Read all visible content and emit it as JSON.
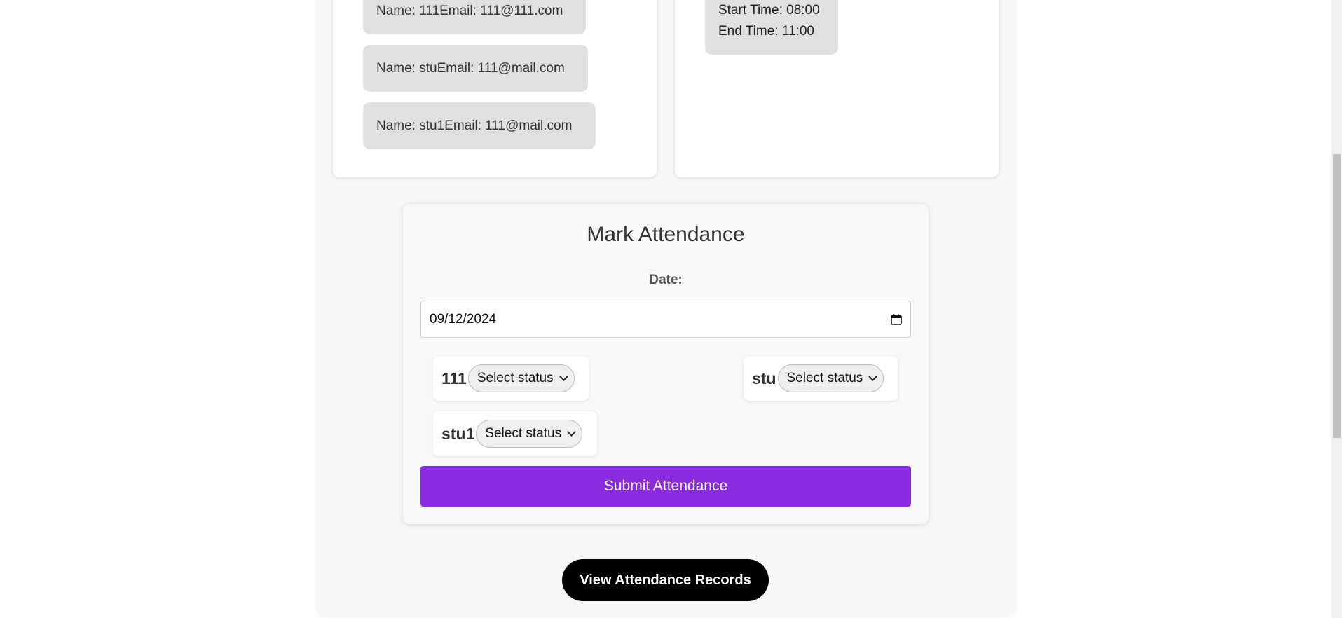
{
  "students_list": [
    {
      "text": "Name: 111Email: 111@111.com"
    },
    {
      "text": "Name: stuEmail: 111@mail.com"
    },
    {
      "text": "Name: stu1Email: 111@mail.com"
    }
  ],
  "schedule": {
    "start": "Start Time: 08:00",
    "end": "End Time: 11:00"
  },
  "attendance": {
    "title": "Mark Attendance",
    "date_label": "Date:",
    "date_value": "09/12/2024",
    "students": [
      {
        "name": "111",
        "status": "Select status"
      },
      {
        "name": "stu",
        "status": "Select status"
      },
      {
        "name": "stu1",
        "status": "Select status"
      }
    ],
    "submit_label": "Submit Attendance"
  },
  "view_records_label": "View Attendance Records",
  "colors": {
    "accent": "#8a2be2",
    "button_dark": "#000000",
    "pill_bg": "#e0e0e0"
  }
}
